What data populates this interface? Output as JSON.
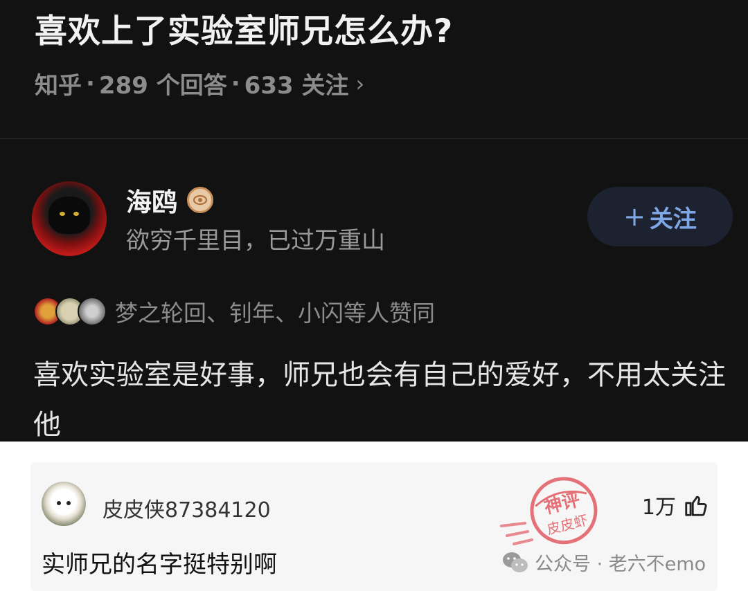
{
  "question": {
    "title": "喜欢上了实验室师兄怎么办?",
    "source": "知乎",
    "answers": "289 个回答",
    "followers": "633 关注",
    "sep": "·"
  },
  "answer": {
    "author_name": "海鸥",
    "author_bio": "欲穷千里目，已过万重山",
    "follow_label": "关注",
    "voters_text": "梦之轮回、钊年、小闪等人赞同",
    "text": "喜欢实验室是好事，师兄也会有自己的爱好，不用太关注他"
  },
  "comment": {
    "user": "皮皮侠87384120",
    "likes": "1万",
    "text": "实师兄的名字挺特别啊"
  },
  "watermark": {
    "label": "公众号 · 老六不emo",
    "stamp_top": "神评",
    "stamp_bottom": "皮皮虾"
  },
  "icons": {
    "chevron": "chevron-right-icon",
    "badge": "certified-badge-icon",
    "plus": "plus-icon",
    "like": "thumbs-up-icon",
    "wechat": "wechat-icon"
  },
  "colors": {
    "dark_bg": "#121212",
    "follow_text": "#7fa7e6",
    "follow_bg": "#1c2230",
    "stamp": "#e0454f"
  }
}
